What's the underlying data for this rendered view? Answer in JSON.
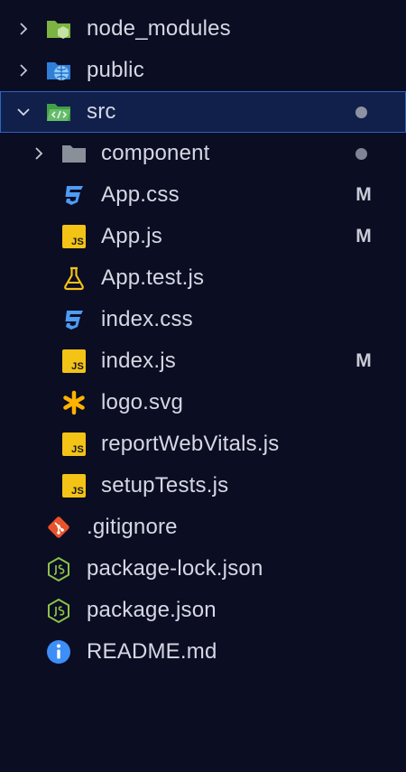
{
  "explorer": {
    "items": [
      {
        "label": "node_modules",
        "status": "",
        "dot": false
      },
      {
        "label": "public",
        "status": "",
        "dot": false
      },
      {
        "label": "src",
        "status": "",
        "dot": true
      },
      {
        "label": "component",
        "status": "",
        "dot": true
      },
      {
        "label": "App.css",
        "status": "M",
        "dot": false
      },
      {
        "label": "App.js",
        "status": "M",
        "dot": false
      },
      {
        "label": "App.test.js",
        "status": "",
        "dot": false
      },
      {
        "label": "index.css",
        "status": "",
        "dot": false
      },
      {
        "label": "index.js",
        "status": "M",
        "dot": false
      },
      {
        "label": "logo.svg",
        "status": "",
        "dot": false
      },
      {
        "label": "reportWebVitals.js",
        "status": "",
        "dot": false
      },
      {
        "label": "setupTests.js",
        "status": "",
        "dot": false
      },
      {
        "label": ".gitignore",
        "status": "",
        "dot": false
      },
      {
        "label": "package-lock.json",
        "status": "",
        "dot": false
      },
      {
        "label": "package.json",
        "status": "",
        "dot": false
      },
      {
        "label": "README.md",
        "status": "",
        "dot": false
      }
    ],
    "js_badge": "JS",
    "colors": {
      "background": "#0b0d23",
      "selection_bg": "#10204a",
      "selection_border": "#2f63c7",
      "js_yellow": "#f3c316",
      "css_blue": "#4d9cf5",
      "node_green": "#8bc34a",
      "git_orange": "#e8532b",
      "info_blue": "#3e8ef7",
      "svg_orange": "#ffb300"
    }
  }
}
